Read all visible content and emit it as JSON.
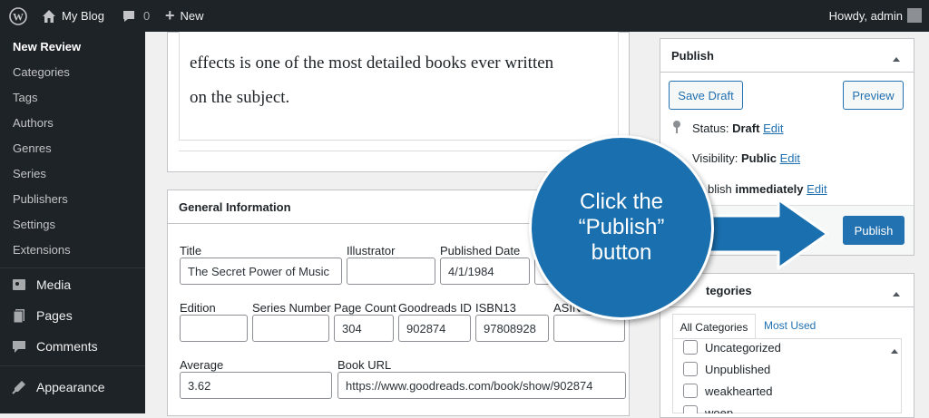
{
  "admin_bar": {
    "site_name": "My Blog",
    "comments_count": "0",
    "new_label": "New",
    "howdy": "Howdy, admin"
  },
  "sidebar": {
    "submenu": [
      "New Review",
      "Categories",
      "Tags",
      "Authors",
      "Genres",
      "Series",
      "Publishers",
      "Settings",
      "Extensions"
    ],
    "menu": [
      {
        "label": "Media",
        "icon": "media-icon"
      },
      {
        "label": "Pages",
        "icon": "pages-icon"
      },
      {
        "label": "Comments",
        "icon": "comments-icon"
      },
      {
        "label": "Appearance",
        "icon": "appearance-icon"
      }
    ]
  },
  "editor": {
    "line1": "effects is one of the most detailed books ever written",
    "line2": "on the subject."
  },
  "general_info": {
    "title": "General Information",
    "fields": {
      "title": {
        "label": "Title",
        "value": "The Secret Power of Music"
      },
      "illustrator": {
        "label": "Illustrator",
        "value": ""
      },
      "published_date": {
        "label": "Published Date",
        "value": "4/1/1984"
      },
      "edition": {
        "label": "Edition",
        "value": ""
      },
      "series_number": {
        "label": "Series Number",
        "value": ""
      },
      "page_count": {
        "label": "Page Count",
        "value": "304"
      },
      "goodreads_id": {
        "label": "Goodreads ID",
        "value": "902874"
      },
      "isbn13": {
        "label": "ISBN13",
        "value": "97808928"
      },
      "asin": {
        "label": "ASIN",
        "value": ""
      },
      "average": {
        "label": "Average",
        "value": "3.62"
      },
      "book_url": {
        "label": "Book URL",
        "value": "https://www.goodreads.com/book/show/902874"
      }
    }
  },
  "publish_box": {
    "title": "Publish",
    "save_draft": "Save Draft",
    "preview": "Preview",
    "status_label": "Status:",
    "status_value": "Draft",
    "visibility_label": "Visibility:",
    "visibility_value": "Public",
    "publish_label_partial": "blish",
    "publish_when": "immediately",
    "edit": "Edit",
    "publish_button": "Publish"
  },
  "categories_box": {
    "title_partial": "tegories",
    "tab_all": "All Categories",
    "tab_most_used": "Most Used",
    "items": [
      "Uncategorized",
      "Unpublished",
      "weakhearted",
      "woep"
    ]
  },
  "callout": {
    "line1": "Click the",
    "line2": "“Publish”",
    "line3": "button",
    "color": "#1a6fae"
  }
}
